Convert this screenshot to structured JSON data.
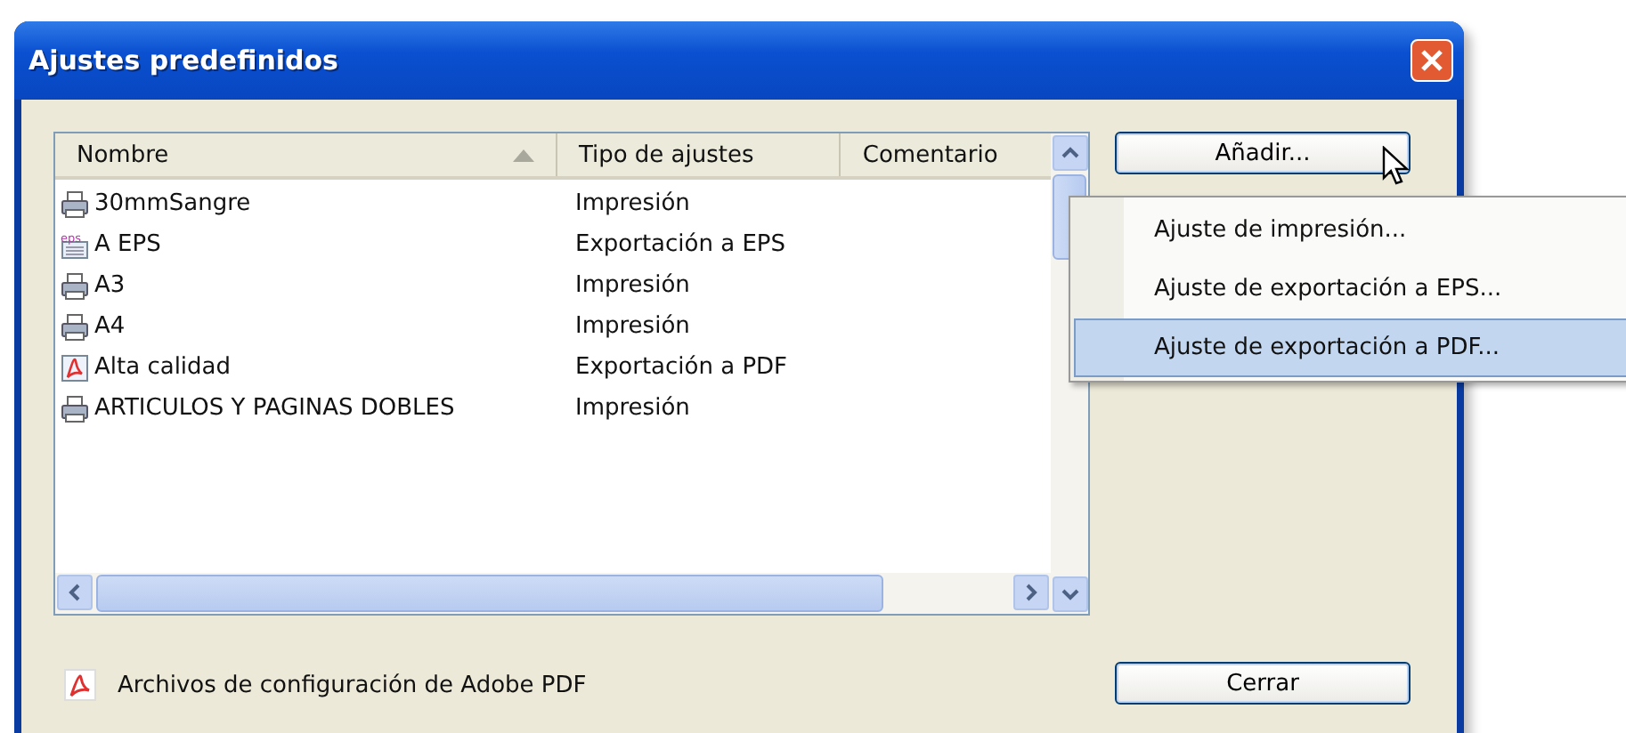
{
  "window": {
    "title": "Ajustes predefinidos"
  },
  "table": {
    "columns": [
      {
        "label": "Nombre",
        "sorted": true
      },
      {
        "label": "Tipo de ajustes",
        "sorted": false
      },
      {
        "label": "Comentario",
        "sorted": false
      }
    ],
    "rows": [
      {
        "kind": "printer",
        "name": "30mmSangre",
        "type": "Impresión"
      },
      {
        "kind": "eps",
        "name": "A EPS",
        "type": "Exportación a EPS"
      },
      {
        "kind": "printer",
        "name": "A3",
        "type": "Impresión"
      },
      {
        "kind": "printer",
        "name": "A4",
        "type": "Impresión"
      },
      {
        "kind": "pdf",
        "name": "Alta calidad",
        "type": "Exportación a PDF"
      },
      {
        "kind": "printer",
        "name": "ARTICULOS Y PAGINAS DOBLES",
        "type": "Impresión"
      }
    ]
  },
  "buttons": {
    "add": "Añadir...",
    "close": "Cerrar"
  },
  "menu": [
    {
      "label": "Ajuste de impresión...",
      "selected": false
    },
    {
      "label": "Ajuste de exportación a EPS...",
      "selected": false
    },
    {
      "label": "Ajuste de exportación a PDF...",
      "selected": true
    }
  ],
  "footer": {
    "label": "Archivos de configuración de Adobe PDF"
  }
}
